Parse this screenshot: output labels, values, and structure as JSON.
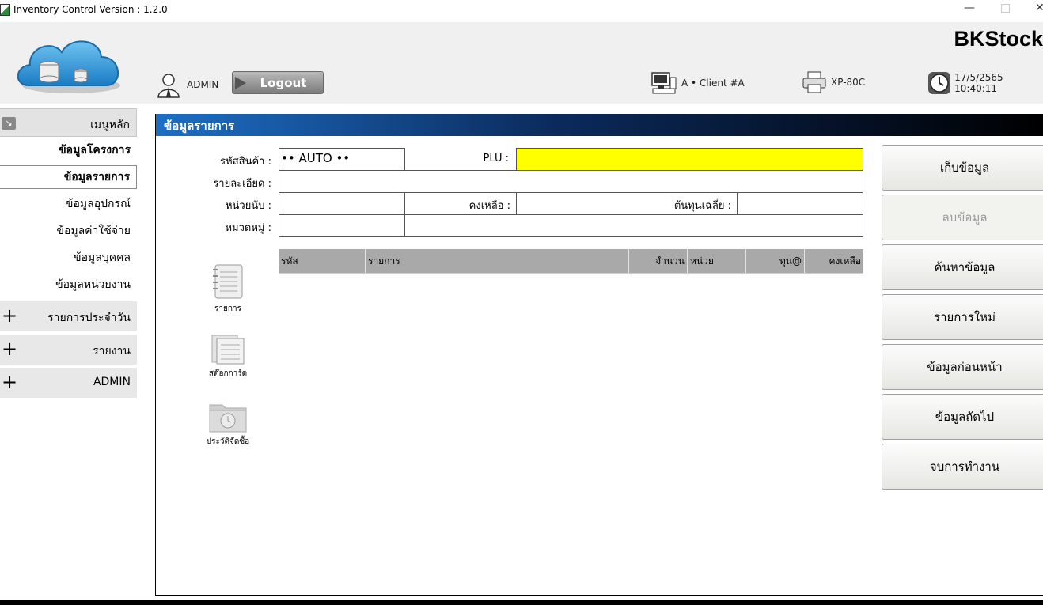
{
  "window": {
    "title": "Inventory Control Version : 1.2.0",
    "minimize": "—",
    "maximize": "□",
    "close": "✕"
  },
  "header": {
    "brand": "BKStock",
    "user": "ADMIN",
    "logout_label": "Logout",
    "client": "A • Client #A",
    "printer": "XP-80C",
    "datetime": "17/5/2565 10:40:11"
  },
  "sidebar": {
    "main_menu": "เมนูหลัก",
    "items": [
      {
        "label": "ข้อมูลโครงการ"
      },
      {
        "label": "ข้อมูลรายการ"
      },
      {
        "label": "ข้อมูลอุปกรณ์"
      },
      {
        "label": "ข้อมูลค่าใช้จ่าย"
      },
      {
        "label": "ข้อมูลบุคคล"
      },
      {
        "label": "ข้อมูลหน่วยงาน"
      }
    ],
    "groups": [
      {
        "label": "รายการประจำวัน"
      },
      {
        "label": "รายงาน"
      },
      {
        "label": "ADMIN"
      }
    ]
  },
  "panel": {
    "title": "ข้อมูลรายการ",
    "fields": {
      "code_label": "รหัสสินค้า :",
      "code_value": "•• AUTO ••",
      "plu_label": "PLU :",
      "plu_value": "",
      "detail_label": "รายละเอียด :",
      "unit_label": "หน่วยนับ :",
      "remain_label": "คงเหลือ :",
      "avgcost_label": "ต้นทุนเฉลี่ย :",
      "category_label": "หมวดหมู่ :"
    },
    "grid_columns": [
      "รหัส",
      "รายการ",
      "จำนวน",
      "หน่วย",
      "ทุน@",
      "คงเหลือ"
    ],
    "side_icons": [
      "รายการ",
      "สต๊อกการ์ด",
      "ประวัติจัดซื้อ"
    ]
  },
  "actions": [
    "เก็บข้อมูล",
    "ลบข้อมูล",
    "ค้นหาข้อมูล",
    "รายการใหม่",
    "ข้อมูลก่อนหน้า",
    "ข้อมูลถัดไป",
    "จบการทำงาน"
  ]
}
